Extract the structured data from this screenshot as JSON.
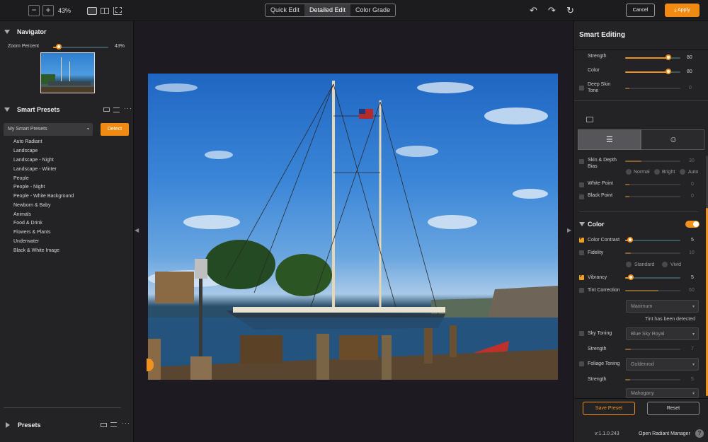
{
  "toolbar": {
    "zoom_minus": "−",
    "zoom_plus": "+",
    "zoom_value": "43%",
    "modes": [
      "Quick Edit",
      "Detailed Edit",
      "Color Grade"
    ],
    "active_mode": "Detailed Edit",
    "undo_icon": "undo-icon",
    "redo_icon": "redo-icon",
    "reset_icon": "refresh-icon",
    "cancel_label": "Cancel",
    "apply_label": "Apply",
    "accent_color": "#f08a12"
  },
  "navigator": {
    "title": "Navigator",
    "zoom_label": "Zoom Percent",
    "zoom_value": "43%",
    "zoom_fraction": 0.07
  },
  "smart_presets": {
    "title": "Smart Presets",
    "dropdown_value": "My Smart Presets",
    "detect_label": "Detect",
    "items": [
      "Auto Radiant",
      "Landscape",
      "Landscape - Night",
      "Landscape - Winter",
      "People",
      "People - Night",
      "People - White Background",
      "Newborn & Baby",
      "Animals",
      "Food & Drink",
      "Flowers & Plants",
      "Underwater",
      "Black & White Image"
    ]
  },
  "presets": {
    "title": "Presets",
    "more_label": "···"
  },
  "smart_editing": {
    "title": "Smart Editing",
    "strength_label": "Strength",
    "strength_value": "80",
    "color_label": "Color",
    "color_value": "80",
    "deep_skin_label_1": "Deep Skin",
    "deep_skin_label_2": "Tone",
    "deep_skin_value": "0",
    "skin_depth_label_1": "Skin & Depth",
    "skin_depth_label_2": "Bias",
    "skin_depth_value": "30",
    "bias_options": [
      "Normal",
      "Bright",
      "Auto"
    ],
    "white_point_label": "White Point",
    "white_point_value": "0",
    "black_point_label": "Black Point",
    "black_point_value": "0"
  },
  "color_section": {
    "title": "Color",
    "color_contrast_label": "Color Contrast",
    "color_contrast_value": "5",
    "fidelity_label": "Fidelity",
    "fidelity_value": "10",
    "fidelity_options": [
      "Standard",
      "Vivid"
    ],
    "vibrancy_label": "Vibrancy",
    "vibrancy_value": "5",
    "tint_label": "Tint Correction",
    "tint_value": "60",
    "tint_dropdown": "Maximum",
    "tint_detected": "Tint has been detected",
    "sky_label": "Sky Toning",
    "sky_dropdown": "Blue Sky Royal",
    "sky_strength_label": "Strength",
    "sky_strength_value": "7",
    "foliage_label": "Foliage Toning",
    "foliage_dropdown": "Goldenrod",
    "foliage_strength_label": "Strength",
    "foliage_strength_value": "5",
    "extra_dropdown": "Mahogany"
  },
  "footer": {
    "save_preset_label": "Save Preset",
    "reset_label": "Reset",
    "version": "v:1.1.0.243",
    "manager_label": "Open Radiant Manager",
    "help_label": "?"
  }
}
